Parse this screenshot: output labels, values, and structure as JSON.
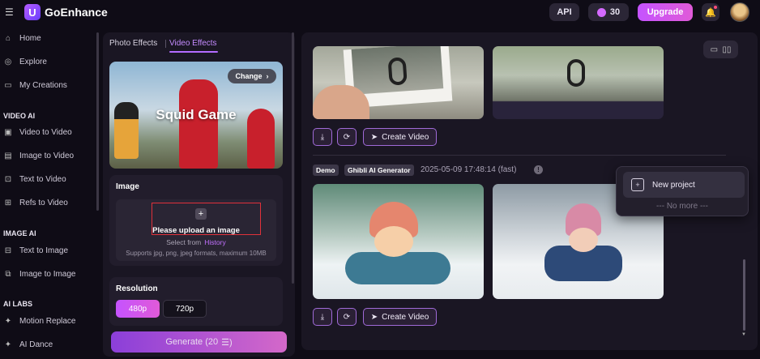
{
  "header": {
    "brand": "GoEnhance",
    "api_label": "API",
    "credits": "30",
    "upgrade_label": "Upgrade"
  },
  "sidebar": {
    "top_items": [
      {
        "label": "Home",
        "icon": "home-icon"
      },
      {
        "label": "Explore",
        "icon": "compass-icon"
      },
      {
        "label": "My Creations",
        "icon": "folder-icon"
      }
    ],
    "sections": [
      {
        "title": "VIDEO AI",
        "items": [
          {
            "label": "Video to Video"
          },
          {
            "label": "Image to Video"
          },
          {
            "label": "Text to Video"
          },
          {
            "label": "Refs to Video"
          }
        ]
      },
      {
        "title": "IMAGE AI",
        "items": [
          {
            "label": "Text to Image"
          },
          {
            "label": "Image to Image"
          }
        ]
      },
      {
        "title": "AI LABS",
        "items": [
          {
            "label": "Motion Replace"
          },
          {
            "label": "AI Dance"
          }
        ]
      }
    ]
  },
  "panel": {
    "tabs": [
      {
        "label": "Photo Effects",
        "active": false
      },
      {
        "label": "Video Effects",
        "active": true
      }
    ],
    "effect": {
      "title": "Squid Game",
      "change_label": "Change"
    },
    "image": {
      "title": "Image",
      "upload_label": "Please upload an image",
      "select_from": "Select from",
      "history_label": "History",
      "formats": "Supports jpg, png, jpeg formats, maximum 10MB"
    },
    "resolution": {
      "title": "Resolution",
      "options": [
        "480p",
        "720p"
      ],
      "selected": "480p"
    },
    "generate_label": "Generate (20"
  },
  "gallery": {
    "create_video_label": "Create Video",
    "entry": {
      "tags": [
        "Demo",
        "Ghibli AI Generator"
      ],
      "timestamp": "2025-05-09 17:48:14 (fast)"
    }
  },
  "popup": {
    "new_project_label": "New project",
    "no_more_label": "--- No more ---"
  },
  "colors": {
    "accent": "#c553ff",
    "accent_pink": "#e05ad8",
    "background": "#0f0c16",
    "panel": "#1a1623"
  }
}
